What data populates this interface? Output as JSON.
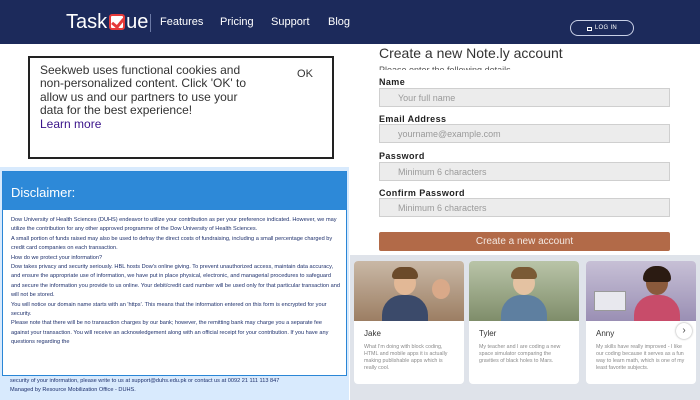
{
  "header": {
    "logo_part1": "Task",
    "logo_part2": "ue",
    "nav": [
      "Features",
      "Pricing",
      "Support",
      "Blog"
    ],
    "login_label": "LOG IN"
  },
  "cookie": {
    "text": "Seekweb uses functional cookies and non-personalized content. Click 'OK' to allow us and our partners to use your data for the best experience!",
    "learn_more": "Learn more",
    "ok_label": "OK"
  },
  "disclaimer": {
    "title": "Disclaimer:",
    "paragraphs": [
      "Dow University of Health Sciences (DUHS) endeavor to utilize your contribution as per your preference indicated. However, we may utilize the contribution for any other approved programme of the Dow University of Health Sciences.",
      "A small portion of funds raised may also be used to defray the direct costs of fundraising, including a small percentage charged by credit card companies on each transaction.",
      "How do we protect your information?",
      "Dow takes privacy and security seriously. HBL hosts Dow's online giving. To prevent unauthorized access, maintain data accuracy, and ensure the appropriate use of information, we have put in place physical, electronic, and managerial procedures to safeguard and secure the information you provide to us online. Your debit/credit card number will be used only for that particular transaction and will not be stored.",
      "You will notice our domain name starts with an 'https'. This means that the information entered on this form is encrypted for your security.",
      "Please note that there will be no transaction charges by our bank; however, the remitting bank may charge you a separate fee against your transaction. You will receive an acknowledgement along with an official receipt for your contribution. If you have any questions regarding the"
    ],
    "tail_1": "security of your information, please write to us at support@duhs.edu.pk or contact us at 0092 21 111 113 847",
    "tail_2": "Managed by Resource Mobilization Office - DUHS."
  },
  "form": {
    "title": "Create a new Note.ly account",
    "subtitle": "Please enter the following details",
    "fields": [
      {
        "label": "Name",
        "placeholder": "Your full name"
      },
      {
        "label": "Email Address",
        "placeholder": "yourname@example.com"
      },
      {
        "label": "Password",
        "placeholder": "Minimum 6 characters"
      },
      {
        "label": "Confirm Password",
        "placeholder": "Minimum 6 characters"
      }
    ],
    "submit_label": "Create a new account"
  },
  "testimonials": [
    {
      "name": "Jake",
      "quote": "What I'm doing with block coding, HTML and mobile apps it is actually making publishable apps which is really cool."
    },
    {
      "name": "Tyler",
      "quote": "My teacher and I are coding a new space simulator comparing the gravities of black holes to Mars."
    },
    {
      "name": "Anny",
      "quote": "My skills have really improved - I like our coding because it serves as a fun way to learn math, which is one of my least favorite subjects."
    }
  ],
  "next_icon": "chevron-right-icon"
}
